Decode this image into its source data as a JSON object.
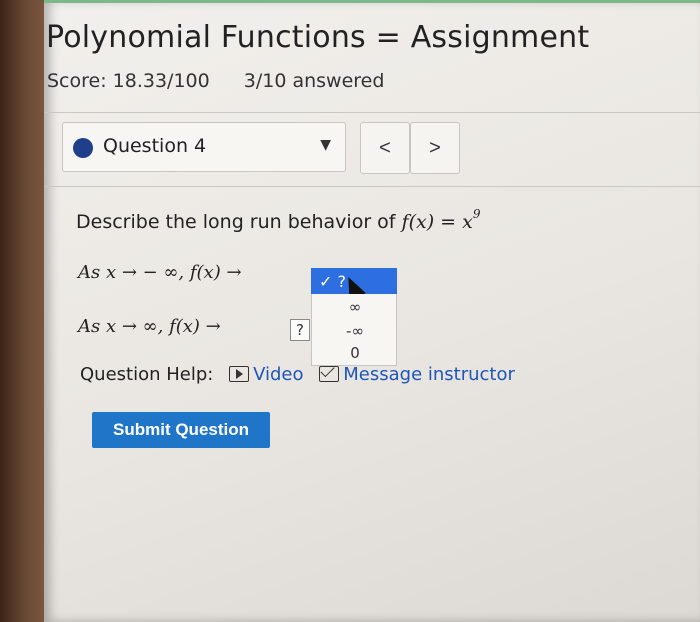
{
  "page": {
    "title": "Polynomial Functions = Assignment",
    "score": "Score: 18.33/100",
    "answered": "3/10 answered"
  },
  "question_nav": {
    "selected_label": "Question 4",
    "prev_label": "<",
    "next_label": ">"
  },
  "question": {
    "prompt_text": "Describe the long run behavior of ",
    "function": "f(x) = x",
    "exponent": "9",
    "line1_text": "As x → − ∞, f(x) →",
    "line2_text": "As x → ∞, f(x) →",
    "line1_selected": "✓ ?",
    "line2_value": "?",
    "options": [
      "∞",
      "-∞",
      "0"
    ]
  },
  "help": {
    "label": "Question Help:",
    "video_link": "Video",
    "message_link": "Message instructor"
  },
  "actions": {
    "submit_label": "Submit Question"
  },
  "colors": {
    "accent": "#2d6fe0",
    "submit": "#1f76c8",
    "link": "#1d56b8"
  }
}
